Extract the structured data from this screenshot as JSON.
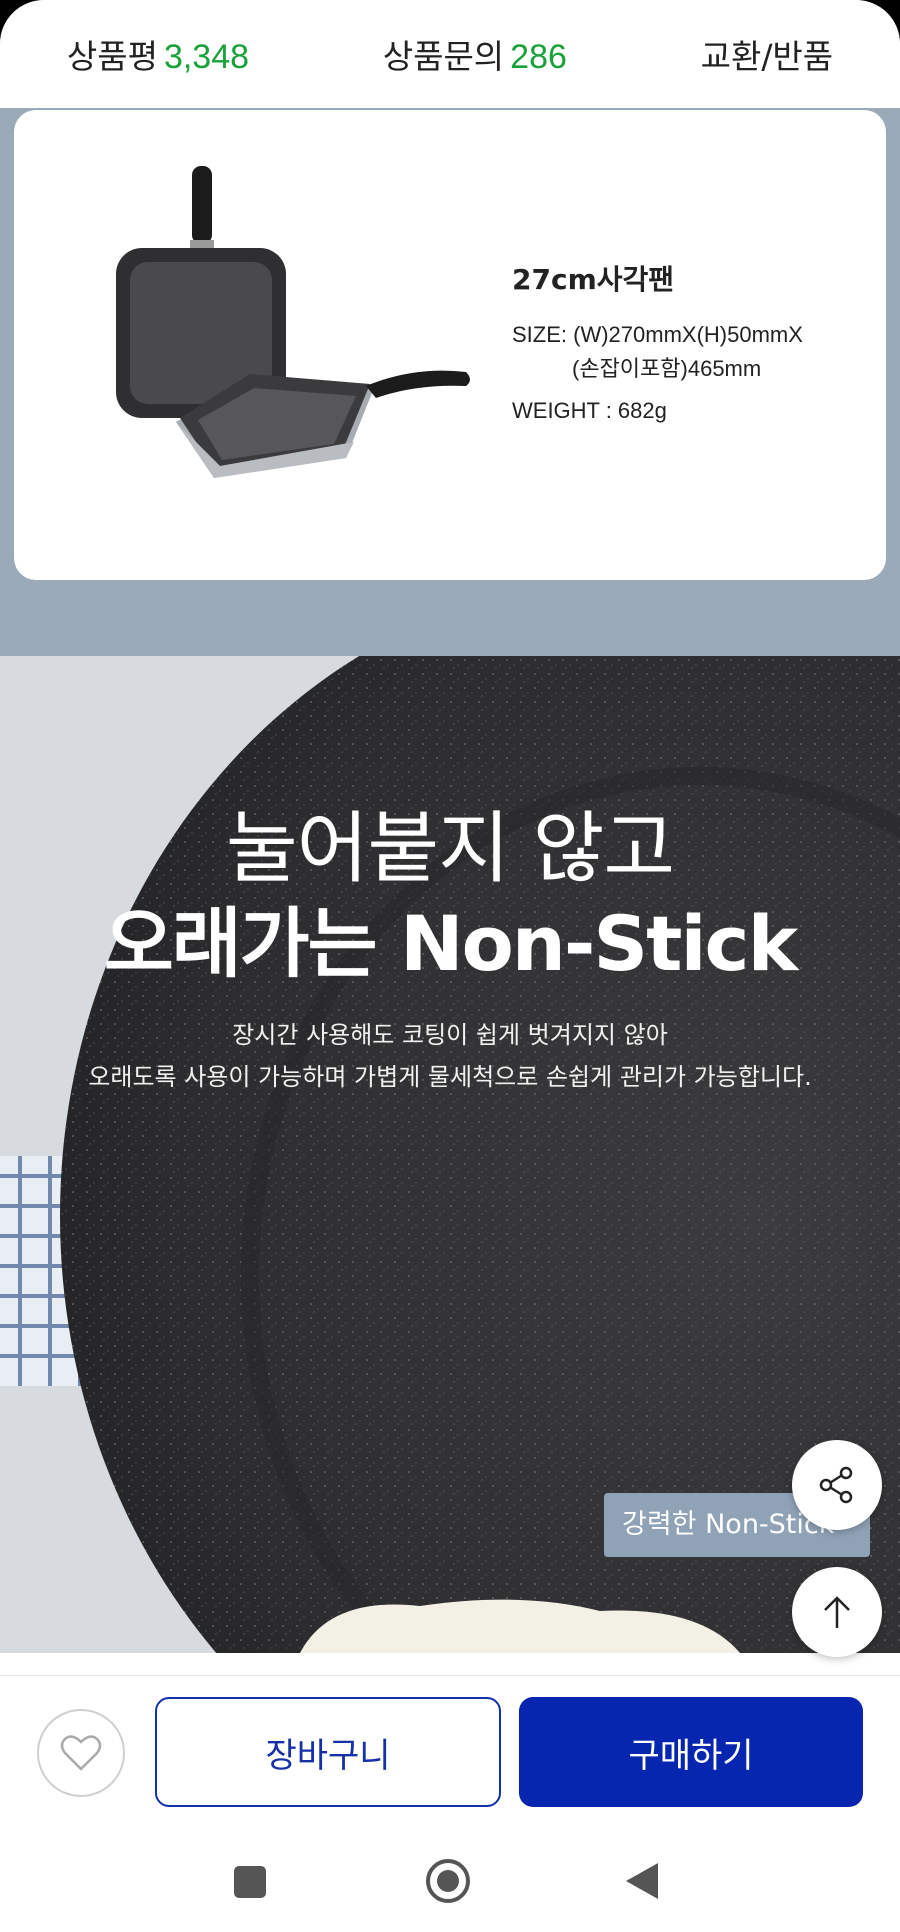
{
  "tabs": {
    "reviews_label": "상품평",
    "reviews_count": "3,348",
    "inquiries_label": "상품문의",
    "inquiries_count": "286",
    "exchange_label": "교환/반품"
  },
  "spec": {
    "title": "27cm사각팬",
    "size_line1": "SIZE: (W)270mmX(H)50mmX",
    "size_line2": "(손잡이포함)465mm",
    "weight": "WEIGHT : 682g"
  },
  "hero": {
    "line1": "눌어붙지 않고",
    "line2": "오래가는 Non-Stick",
    "desc_line1": "장시간 사용해도 코팅이 쉽게 벗겨지지 않아",
    "desc_line2": "오래도록 사용이 가능하며 가볍게 물세척으로 손쉽게 관리가 가능합니다.",
    "tag": "강력한 Non-Stick"
  },
  "actions": {
    "cart_label": "장바구니",
    "buy_label": "구매하기"
  },
  "icons": {
    "heart": "heart-icon",
    "share": "share-icon",
    "scroll_top": "arrow-up-icon",
    "nav_recents": "recents-icon",
    "nav_home": "home-icon",
    "nav_back": "back-icon"
  },
  "colors": {
    "count_green": "#1aa23a",
    "brand_blue": "#0626b0",
    "spec_bg": "#9aaab8",
    "tag_bg": "#8fa2b6"
  }
}
